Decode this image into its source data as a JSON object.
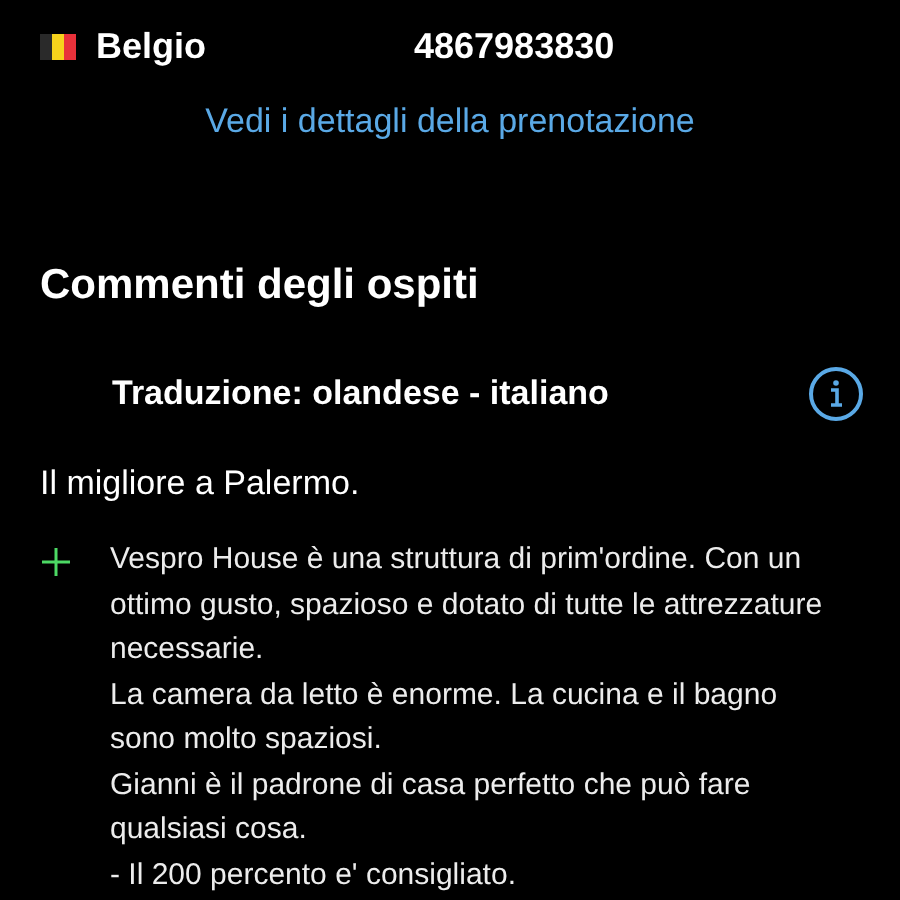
{
  "booking_info": [
    {
      "value": "Belgio",
      "kind": "country"
    },
    {
      "value": "4867983830",
      "kind": "plain"
    }
  ],
  "details_link": "Vedi i dettagli della prenotazione",
  "reviews": {
    "title": "Commenti degli ospiti",
    "translation": "Traduzione: olandese - italiano",
    "review_title": "Il migliore a Palermo.",
    "positive": [
      "Vespro House è una struttura di prim'ordine. Con un ottimo gusto, spazioso e dotato di tutte le attrezzature necessarie.",
      "La camera da letto è enorme. La cucina e il bagno sono molto spaziosi.",
      "Gianni è il padrone di casa perfetto che può fare qualsiasi cosa.",
      "- Il 200 percento e' consigliato."
    ]
  }
}
